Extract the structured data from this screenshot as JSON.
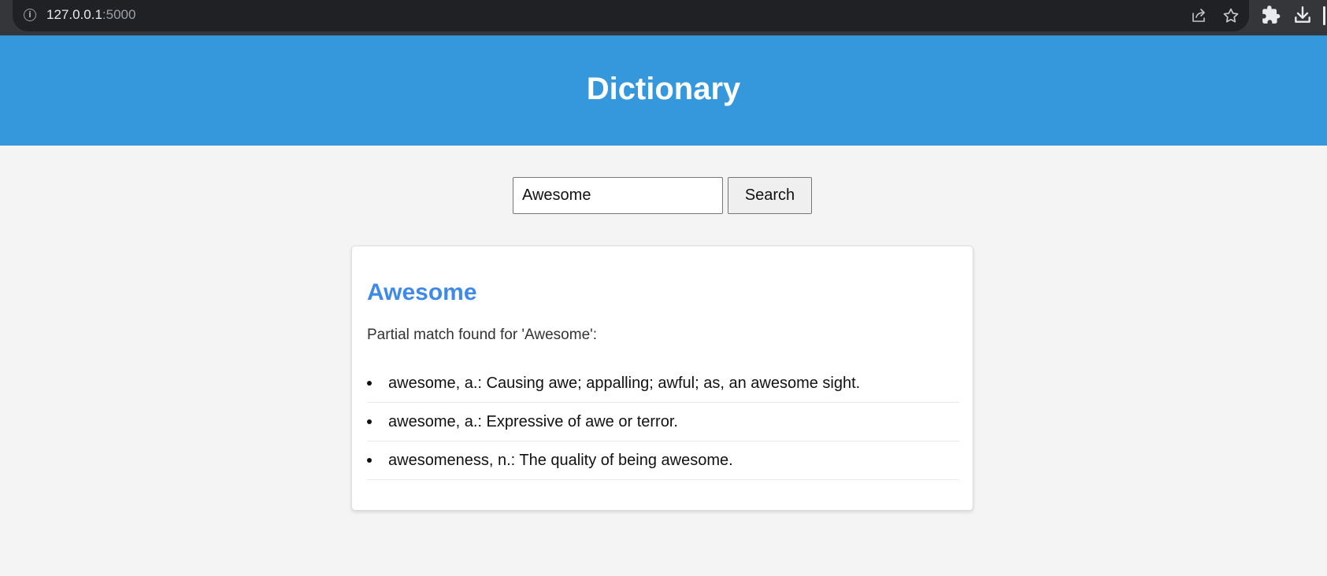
{
  "browser": {
    "url_host": "127.0.0.1",
    "url_port": ":5000",
    "info_icon": "i"
  },
  "header": {
    "title": "Dictionary",
    "bg_color": "#3598dc"
  },
  "search": {
    "value": "Awesome",
    "button_label": "Search"
  },
  "result": {
    "word": "Awesome",
    "word_color": "#3f8ae8",
    "note": "Partial match found for 'Awesome':",
    "definitions": [
      {
        "text": "awesome, a.: Causing awe; appalling; awful; as, an awesome sight."
      },
      {
        "text": "awesome, a.: Expressive of awe or terror."
      },
      {
        "text": "awesomeness, n.: The quality of being awesome."
      }
    ]
  },
  "icons": {
    "info": "info-icon",
    "share": "share-icon",
    "star": "star-icon",
    "extensions": "puzzle-icon",
    "download": "download-icon"
  }
}
